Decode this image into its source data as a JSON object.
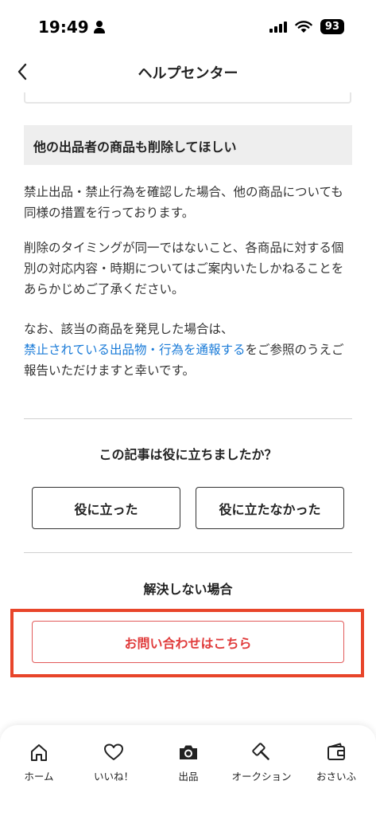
{
  "status_bar": {
    "time": "19:49",
    "battery": "93"
  },
  "header": {
    "title": "ヘルプセンター"
  },
  "article": {
    "section_heading": "他の出品者の商品も削除してほしい",
    "paragraph_1": "禁止出品・禁止行為を確認した場合、他の商品についても同様の措置を行っております。",
    "paragraph_2": "削除のタイミングが同一ではないこと、各商品に対する個別の対応内容・時期についてはご案内いたしかねることをあらかじめご了承ください。",
    "paragraph_3_prefix": "なお、該当の商品を発見した場合は、",
    "paragraph_3_link": "禁止されている出品物・行為を通報する",
    "paragraph_3_suffix": "をご参照のうえご報告いただけますと幸いです。"
  },
  "feedback": {
    "question": "この記事は役に立ちましたか？",
    "helpful_label": "役に立った",
    "not_helpful_label": "役に立たなかった"
  },
  "support": {
    "unresolved_label": "解決しない場合",
    "contact_label": "お問い合わせはこちら"
  },
  "tab_bar": {
    "items": [
      {
        "label": "ホーム",
        "icon": "home-icon"
      },
      {
        "label": "いいね！",
        "icon": "heart-icon"
      },
      {
        "label": "出品",
        "icon": "camera-icon"
      },
      {
        "label": "オークション",
        "icon": "gavel-icon"
      },
      {
        "label": "おさいふ",
        "icon": "wallet-icon"
      }
    ]
  },
  "colors": {
    "link": "#1a7bd8",
    "contact_accent": "#e03c3c",
    "highlight_box": "#e8452a",
    "heading_bg": "#eeeeee"
  }
}
